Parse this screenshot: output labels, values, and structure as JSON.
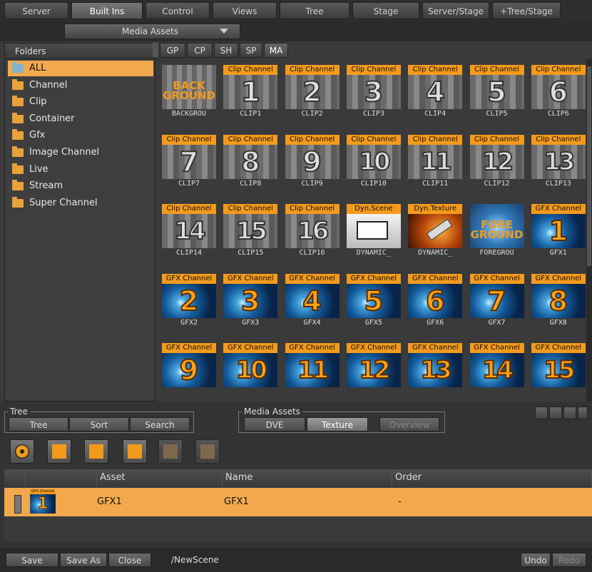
{
  "top_tabs": [
    "Server",
    "Built Ins",
    "Control",
    "Views",
    "Tree",
    "Stage",
    "Server/Stage",
    "+Tree/Stage"
  ],
  "media_select": {
    "value": "Media Assets"
  },
  "folders": {
    "header": "Folders",
    "items": [
      "ALL",
      "Channel",
      "Clip",
      "Container",
      "Gfx",
      "Image Channel",
      "Live",
      "Stream",
      "Super Channel"
    ]
  },
  "asset_tabs": [
    "GP",
    "CP",
    "SH",
    "SP",
    "MA"
  ],
  "assets": [
    {
      "badge": "",
      "num": "",
      "name": "BACKGROU",
      "kind": "background",
      "big": "BACK GROUND"
    },
    {
      "badge": "Clip Channel",
      "num": "1",
      "name": "CLIP1",
      "kind": "clip"
    },
    {
      "badge": "Clip Channel",
      "num": "2",
      "name": "CLIP2",
      "kind": "clip"
    },
    {
      "badge": "Clip Channel",
      "num": "3",
      "name": "CLIP3",
      "kind": "clip"
    },
    {
      "badge": "Clip Channel",
      "num": "4",
      "name": "CLIP4",
      "kind": "clip"
    },
    {
      "badge": "Clip Channel",
      "num": "5",
      "name": "CLIP5",
      "kind": "clip"
    },
    {
      "badge": "Clip Channel",
      "num": "6",
      "name": "CLIP6",
      "kind": "clip"
    },
    {
      "badge": "Clip Channel",
      "num": "7",
      "name": "CLIP7",
      "kind": "clip"
    },
    {
      "badge": "Clip Channel",
      "num": "8",
      "name": "CLIP8",
      "kind": "clip"
    },
    {
      "badge": "Clip Channel",
      "num": "9",
      "name": "CLIP9",
      "kind": "clip"
    },
    {
      "badge": "Clip Channel",
      "num": "10",
      "name": "CLIP10",
      "kind": "clip"
    },
    {
      "badge": "Clip Channel",
      "num": "11",
      "name": "CLIP11",
      "kind": "clip"
    },
    {
      "badge": "Clip Channel",
      "num": "12",
      "name": "CLIP12",
      "kind": "clip"
    },
    {
      "badge": "Clip Channel",
      "num": "13",
      "name": "CLIP13",
      "kind": "clip"
    },
    {
      "badge": "Clip Channel",
      "num": "14",
      "name": "CLIP14",
      "kind": "clip"
    },
    {
      "badge": "Clip Channel",
      "num": "15",
      "name": "CLIP15",
      "kind": "clip"
    },
    {
      "badge": "Clip Channel",
      "num": "16",
      "name": "CLIP16",
      "kind": "clip"
    },
    {
      "badge": "Dyn.Scene",
      "num": "",
      "name": "DYNAMIC_",
      "kind": "dynscene"
    },
    {
      "badge": "Dyn.Texture",
      "num": "",
      "name": "DYNAMIC_",
      "kind": "dyntexture"
    },
    {
      "badge": "",
      "num": "",
      "name": "FOREGROU",
      "kind": "foreground",
      "big": "FORE GROUND"
    },
    {
      "badge": "GFX Channel",
      "num": "1",
      "name": "GFX1",
      "kind": "gfx"
    },
    {
      "badge": "GFX Channel",
      "num": "2",
      "name": "GFX2",
      "kind": "gfx"
    },
    {
      "badge": "GFX Channel",
      "num": "3",
      "name": "GFX3",
      "kind": "gfx"
    },
    {
      "badge": "GFX Channel",
      "num": "4",
      "name": "GFX4",
      "kind": "gfx"
    },
    {
      "badge": "GFX Channel",
      "num": "5",
      "name": "GFX5",
      "kind": "gfx"
    },
    {
      "badge": "GFX Channel",
      "num": "6",
      "name": "GFX6",
      "kind": "gfx"
    },
    {
      "badge": "GFX Channel",
      "num": "7",
      "name": "GFX7",
      "kind": "gfx"
    },
    {
      "badge": "GFX Channel",
      "num": "8",
      "name": "GFX8",
      "kind": "gfx"
    },
    {
      "badge": "GFX Channel",
      "num": "9",
      "name": "",
      "kind": "gfx"
    },
    {
      "badge": "GFX Channel",
      "num": "10",
      "name": "",
      "kind": "gfx"
    },
    {
      "badge": "GFX Channel",
      "num": "11",
      "name": "",
      "kind": "gfx"
    },
    {
      "badge": "GFX Channel",
      "num": "12",
      "name": "",
      "kind": "gfx"
    },
    {
      "badge": "GFX Channel",
      "num": "13",
      "name": "",
      "kind": "gfx"
    },
    {
      "badge": "GFX Channel",
      "num": "14",
      "name": "",
      "kind": "gfx"
    },
    {
      "badge": "GFX Channel",
      "num": "15",
      "name": "",
      "kind": "gfx"
    }
  ],
  "tree_group": {
    "title": "Tree",
    "buttons": [
      "Tree",
      "Sort",
      "Search"
    ]
  },
  "media_group": {
    "title": "Media Assets",
    "buttons": [
      "DVE",
      "Texture",
      "Overview"
    ]
  },
  "tool_icons": [
    "film-reel-icon",
    "clip-strip-icon",
    "image-icon",
    "container-icon",
    "tv-icon",
    "stream-icon"
  ],
  "table": {
    "headers": [
      "Asset",
      "Name",
      "Order"
    ],
    "row": {
      "badge": "GFX Channel",
      "num": "1",
      "asset": "GFX1",
      "name": "GFX1",
      "order": "-"
    }
  },
  "bottom": {
    "save": "Save",
    "save_as": "Save As",
    "close": "Close",
    "path": "/NewScene",
    "undo": "Undo",
    "redo": "Redo"
  },
  "colors": {
    "accent": "#f2a94e",
    "badge": "#f39a1c",
    "gfx_blue": "#135a9a"
  }
}
